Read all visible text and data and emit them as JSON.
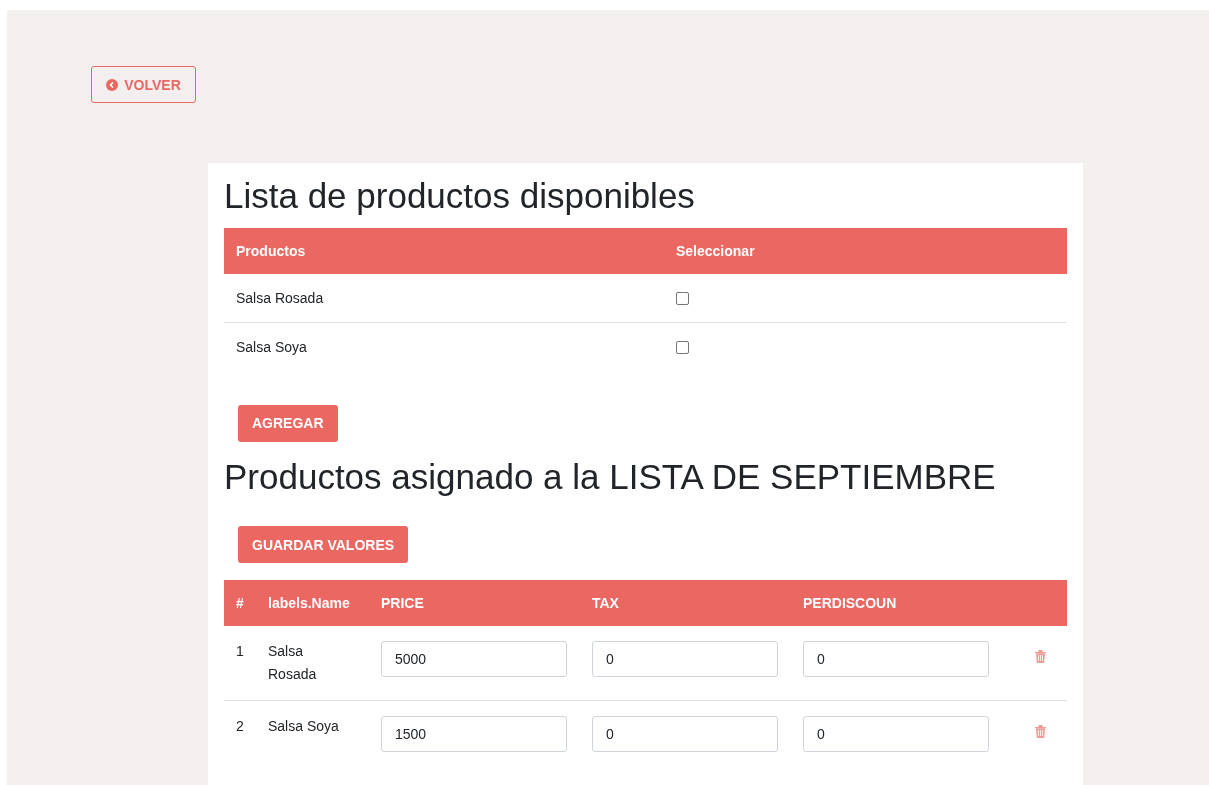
{
  "back_button": {
    "label": "VOLVER"
  },
  "available": {
    "title": "Lista de productos disponibles",
    "columns": [
      "Productos",
      "Seleccionar"
    ],
    "rows": [
      {
        "name": "Salsa Rosada",
        "checked": false
      },
      {
        "name": "Salsa Soya",
        "checked": false
      }
    ],
    "add_button": "AGREGAR"
  },
  "assigned": {
    "title": "Productos asignado a la LISTA DE SEPTIEMBRE",
    "save_button": "GUARDAR VALORES",
    "columns": [
      "#",
      "labels.Name",
      "PRICE",
      "TAX",
      "PERDISCOUN"
    ],
    "rows": [
      {
        "index": "1",
        "name": "Salsa Rosada",
        "price": "5000",
        "tax": "0",
        "perdiscount": "0"
      },
      {
        "index": "2",
        "name": "Salsa Soya",
        "price": "1500",
        "tax": "0",
        "perdiscount": "0"
      }
    ]
  }
}
